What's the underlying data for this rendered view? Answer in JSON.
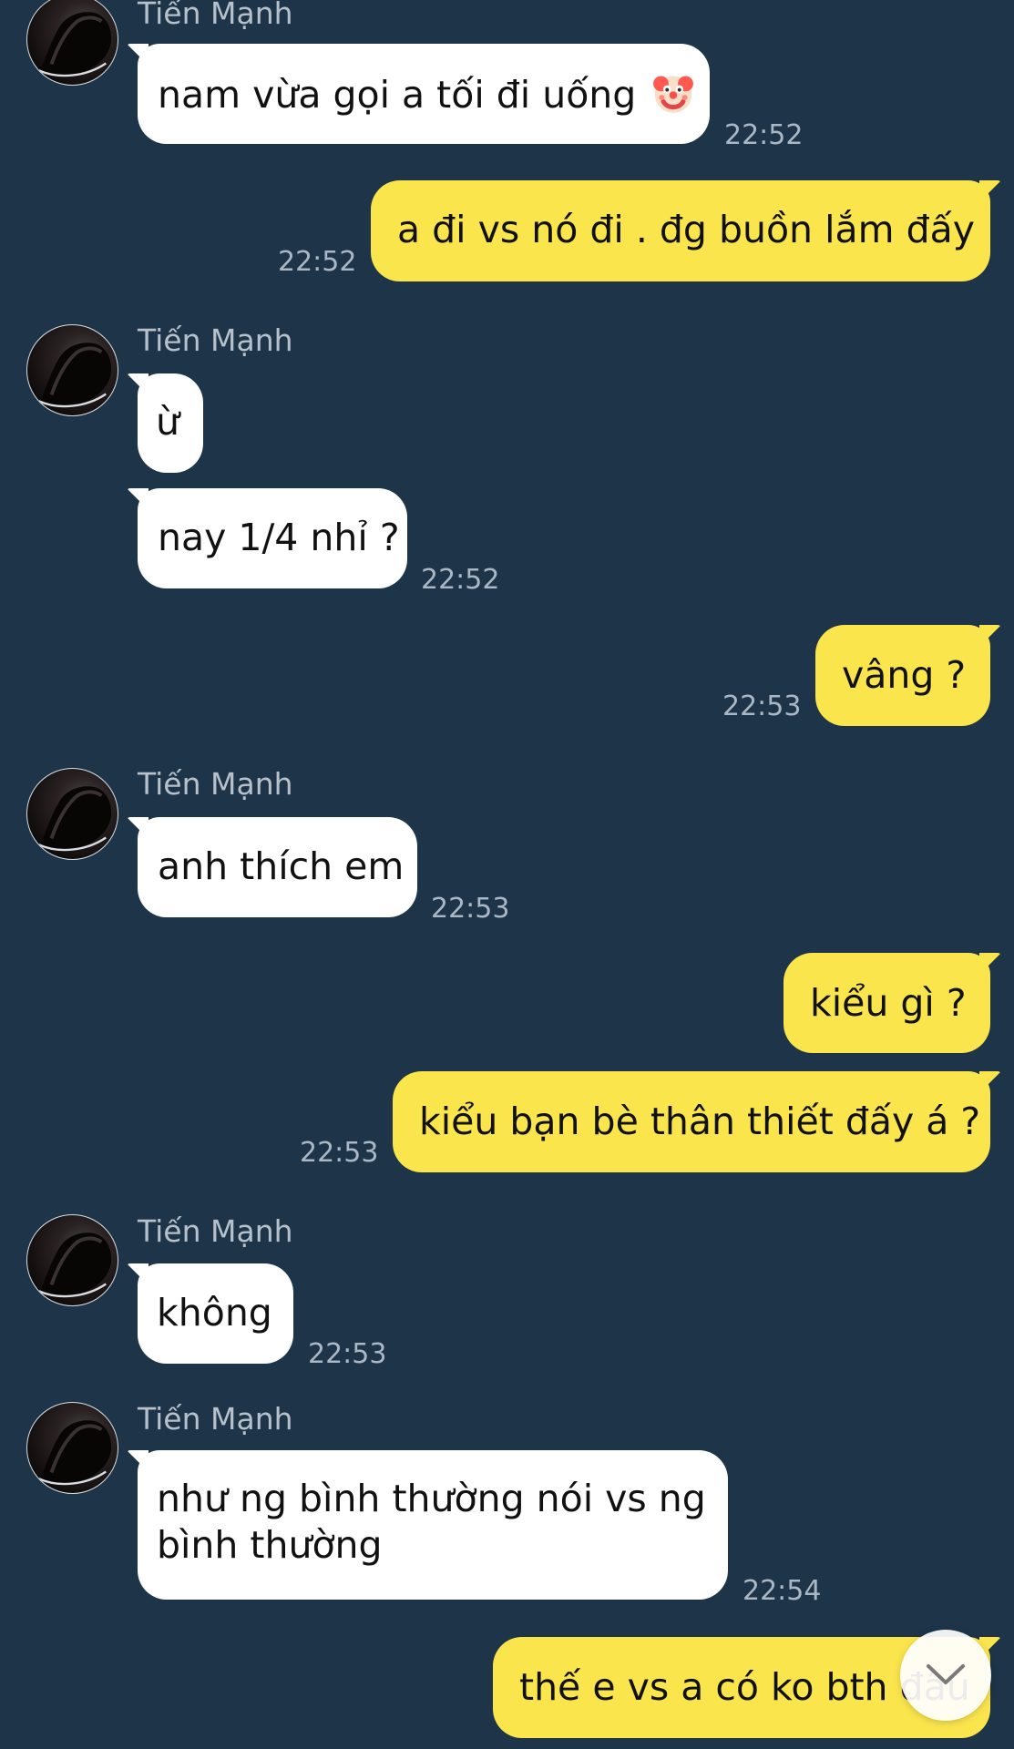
{
  "colors": {
    "background": "#1e3448",
    "incoming_bubble": "#ffffff",
    "outgoing_bubble": "#fbe54d",
    "meta_text": "#aab7c4"
  },
  "contact": {
    "name": "Tiến Mạnh"
  },
  "messages": [
    {
      "direction": "incoming",
      "sender": "Tiến Mạnh",
      "text": "nam vừa gọi a tối đi uống",
      "emoji": "clown-face",
      "time": "22:52"
    },
    {
      "direction": "outgoing",
      "text": "a đi vs nó đi . đg buồn lắm đấy",
      "time": "22:52"
    },
    {
      "direction": "incoming",
      "sender": "Tiến Mạnh",
      "text": "ừ"
    },
    {
      "direction": "incoming",
      "text": "nay 1/4 nhỉ ?",
      "time": "22:52"
    },
    {
      "direction": "outgoing",
      "text": "vâng ?",
      "time": "22:53"
    },
    {
      "direction": "incoming",
      "sender": "Tiến Mạnh",
      "text": "anh thích em",
      "time": "22:53"
    },
    {
      "direction": "outgoing",
      "text": "kiểu gì ?"
    },
    {
      "direction": "outgoing",
      "text": "kiểu bạn bè thân thiết đấy á ?",
      "time": "22:53"
    },
    {
      "direction": "incoming",
      "sender": "Tiến Mạnh",
      "text": "không",
      "time": "22:53"
    },
    {
      "direction": "incoming",
      "sender": "Tiến Mạnh",
      "text": "như ng bình thường nói vs ng\nbình thường",
      "time": "22:54"
    },
    {
      "direction": "outgoing",
      "text": "thế e vs a có ko bth đâu"
    }
  ],
  "controls": {
    "scroll_down_icon": "chevron-down-icon"
  }
}
